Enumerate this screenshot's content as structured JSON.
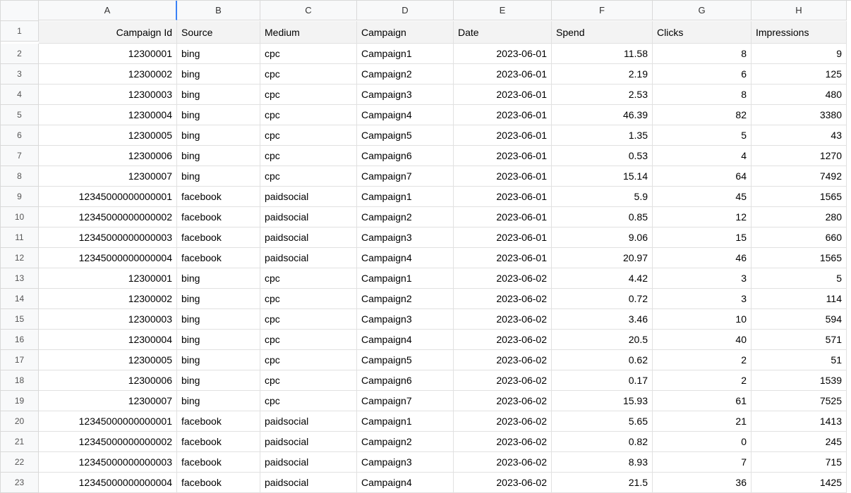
{
  "columns": [
    "",
    "A",
    "B",
    "C",
    "D",
    "E",
    "F",
    "G",
    "H"
  ],
  "headers": [
    "Campaign Id",
    "Source",
    "Medium",
    "Campaign",
    "Date",
    "Spend",
    "Clicks",
    "Impressions"
  ],
  "rows": [
    {
      "n": 1
    },
    {
      "n": 2,
      "a": "12300001",
      "b": "bing",
      "c": "cpc",
      "d": "Campaign1",
      "e": "2023-06-01",
      "f": "11.58",
      "g": "8",
      "h": "9"
    },
    {
      "n": 3,
      "a": "12300002",
      "b": "bing",
      "c": "cpc",
      "d": "Campaign2",
      "e": "2023-06-01",
      "f": "2.19",
      "g": "6",
      "h": "125"
    },
    {
      "n": 4,
      "a": "12300003",
      "b": "bing",
      "c": "cpc",
      "d": "Campaign3",
      "e": "2023-06-01",
      "f": "2.53",
      "g": "8",
      "h": "480"
    },
    {
      "n": 5,
      "a": "12300004",
      "b": "bing",
      "c": "cpc",
      "d": "Campaign4",
      "e": "2023-06-01",
      "f": "46.39",
      "g": "82",
      "h": "3380"
    },
    {
      "n": 6,
      "a": "12300005",
      "b": "bing",
      "c": "cpc",
      "d": "Campaign5",
      "e": "2023-06-01",
      "f": "1.35",
      "g": "5",
      "h": "43"
    },
    {
      "n": 7,
      "a": "12300006",
      "b": "bing",
      "c": "cpc",
      "d": "Campaign6",
      "e": "2023-06-01",
      "f": "0.53",
      "g": "4",
      "h": "1270"
    },
    {
      "n": 8,
      "a": "12300007",
      "b": "bing",
      "c": "cpc",
      "d": "Campaign7",
      "e": "2023-06-01",
      "f": "15.14",
      "g": "64",
      "h": "7492"
    },
    {
      "n": 9,
      "a": "12345000000000001",
      "b": "facebook",
      "c": "paidsocial",
      "d": "Campaign1",
      "e": "2023-06-01",
      "f": "5.9",
      "g": "45",
      "h": "1565"
    },
    {
      "n": 10,
      "a": "12345000000000002",
      "b": "facebook",
      "c": "paidsocial",
      "d": "Campaign2",
      "e": "2023-06-01",
      "f": "0.85",
      "g": "12",
      "h": "280"
    },
    {
      "n": 11,
      "a": "12345000000000003",
      "b": "facebook",
      "c": "paidsocial",
      "d": "Campaign3",
      "e": "2023-06-01",
      "f": "9.06",
      "g": "15",
      "h": "660"
    },
    {
      "n": 12,
      "a": "12345000000000004",
      "b": "facebook",
      "c": "paidsocial",
      "d": "Campaign4",
      "e": "2023-06-01",
      "f": "20.97",
      "g": "46",
      "h": "1565"
    },
    {
      "n": 13,
      "a": "12300001",
      "b": "bing",
      "c": "cpc",
      "d": "Campaign1",
      "e": "2023-06-02",
      "f": "4.42",
      "g": "3",
      "h": "5"
    },
    {
      "n": 14,
      "a": "12300002",
      "b": "bing",
      "c": "cpc",
      "d": "Campaign2",
      "e": "2023-06-02",
      "f": "0.72",
      "g": "3",
      "h": "114"
    },
    {
      "n": 15,
      "a": "12300003",
      "b": "bing",
      "c": "cpc",
      "d": "Campaign3",
      "e": "2023-06-02",
      "f": "3.46",
      "g": "10",
      "h": "594"
    },
    {
      "n": 16,
      "a": "12300004",
      "b": "bing",
      "c": "cpc",
      "d": "Campaign4",
      "e": "2023-06-02",
      "f": "20.5",
      "g": "40",
      "h": "571"
    },
    {
      "n": 17,
      "a": "12300005",
      "b": "bing",
      "c": "cpc",
      "d": "Campaign5",
      "e": "2023-06-02",
      "f": "0.62",
      "g": "2",
      "h": "51"
    },
    {
      "n": 18,
      "a": "12300006",
      "b": "bing",
      "c": "cpc",
      "d": "Campaign6",
      "e": "2023-06-02",
      "f": "0.17",
      "g": "2",
      "h": "1539"
    },
    {
      "n": 19,
      "a": "12300007",
      "b": "bing",
      "c": "cpc",
      "d": "Campaign7",
      "e": "2023-06-02",
      "f": "15.93",
      "g": "61",
      "h": "7525"
    },
    {
      "n": 20,
      "a": "12345000000000001",
      "b": "facebook",
      "c": "paidsocial",
      "d": "Campaign1",
      "e": "2023-06-02",
      "f": "5.65",
      "g": "21",
      "h": "1413"
    },
    {
      "n": 21,
      "a": "12345000000000002",
      "b": "facebook",
      "c": "paidsocial",
      "d": "Campaign2",
      "e": "2023-06-02",
      "f": "0.82",
      "g": "0",
      "h": "245"
    },
    {
      "n": 22,
      "a": "12345000000000003",
      "b": "facebook",
      "c": "paidsocial",
      "d": "Campaign3",
      "e": "2023-06-02",
      "f": "8.93",
      "g": "7",
      "h": "715"
    },
    {
      "n": 23,
      "a": "12345000000000004",
      "b": "facebook",
      "c": "paidsocial",
      "d": "Campaign4",
      "e": "2023-06-02",
      "f": "21.5",
      "g": "36",
      "h": "1425"
    }
  ]
}
